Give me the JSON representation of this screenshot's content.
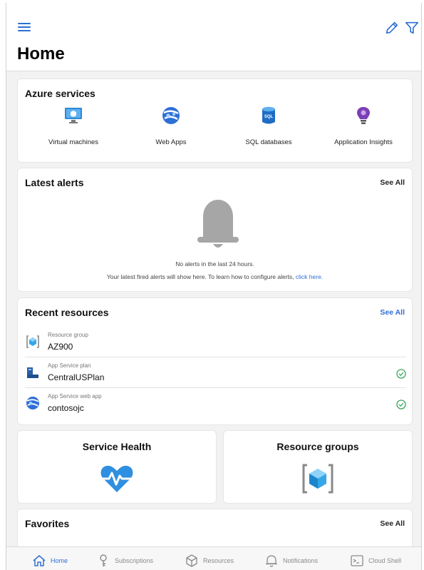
{
  "header": {
    "title": "Home",
    "menu_icon": "hamburger-menu-icon",
    "edit_icon": "pencil-icon",
    "filter_icon": "filter-icon"
  },
  "azure_services": {
    "title": "Azure services",
    "items": [
      {
        "label": "Virtual machines",
        "icon": "virtual-machine-icon"
      },
      {
        "label": "Web Apps",
        "icon": "web-app-icon"
      },
      {
        "label": "SQL databases",
        "icon": "sql-database-icon"
      },
      {
        "label": "Application Insights",
        "icon": "application-insights-icon"
      }
    ]
  },
  "latest_alerts": {
    "title": "Latest alerts",
    "see_all": "See All",
    "empty_line1": "No alerts in the last 24 hours.",
    "empty_line2": "Your latest fired alerts will show here. To learn how to configure alerts,",
    "link": "click here."
  },
  "recent_resources": {
    "title": "Recent resources",
    "see_all": "See All",
    "items": [
      {
        "type": "Resource group",
        "name": "AZ900",
        "status": ""
      },
      {
        "type": "App Service plan",
        "name": "CentralUSPlan",
        "status": "ok"
      },
      {
        "type": "App Service web app",
        "name": "contosojc",
        "status": "ok"
      }
    ]
  },
  "tiles": {
    "service_health": "Service Health",
    "resource_groups": "Resource groups"
  },
  "favorites": {
    "title": "Favorites",
    "see_all": "See All"
  },
  "bottom_nav": [
    {
      "label": "Home",
      "icon": "home-icon",
      "active": true
    },
    {
      "label": "Subscriptions",
      "icon": "key-icon",
      "active": false
    },
    {
      "label": "Resources",
      "icon": "cube-icon",
      "active": false
    },
    {
      "label": "Notifications",
      "icon": "bell-icon",
      "active": false
    },
    {
      "label": "Cloud Shell",
      "icon": "terminal-icon",
      "active": false
    }
  ],
  "colors": {
    "accent": "#2f6fd6",
    "background": "#f2f2f2",
    "ok": "#3aa55b"
  }
}
